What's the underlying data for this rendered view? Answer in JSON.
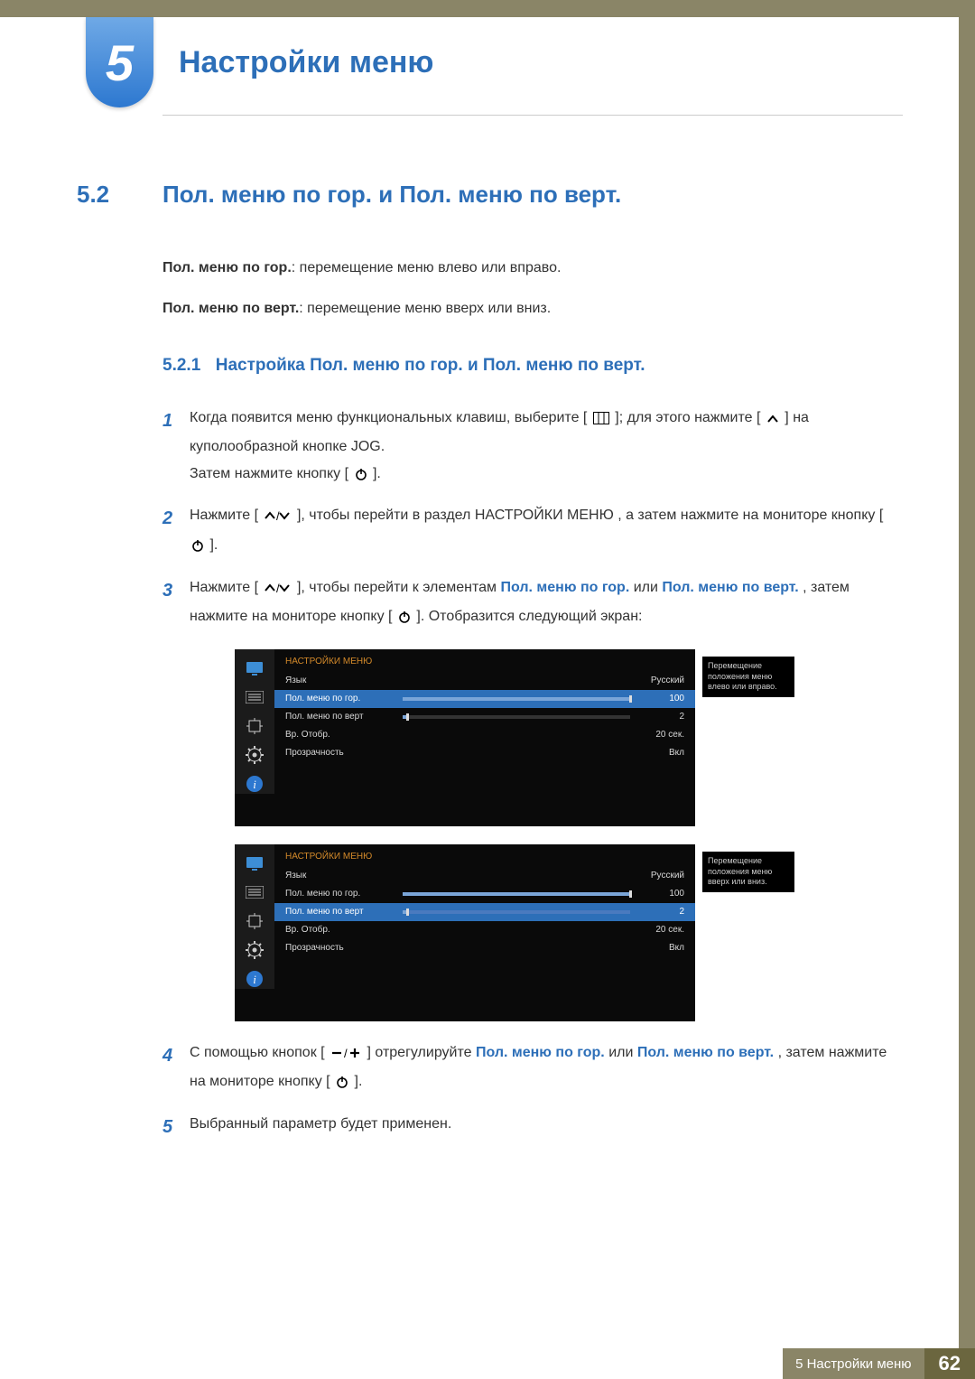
{
  "chapter": {
    "number": "5",
    "title": "Настройки меню"
  },
  "section": {
    "number": "5.2",
    "title": "Пол. меню по гор. и Пол. меню по верт."
  },
  "desc": {
    "h_label": "Пол. меню по гор.",
    "h_text": ": перемещение меню влево или вправо.",
    "v_label": "Пол. меню по верт.",
    "v_text": ": перемещение меню вверх или вниз."
  },
  "subsection": {
    "number": "5.2.1",
    "title": "Настройка Пол. меню по гор. и Пол. меню по верт."
  },
  "steps": {
    "s1a": "Когда появится меню функциональных клавиш, выберите [",
    "s1b": "]; для этого нажмите [",
    "s1c": "] на куполообразной кнопке JOG.",
    "s1d": "Затем нажмите кнопку [",
    "s1e": "].",
    "s2a": "Нажмите [",
    "s2b": "], чтобы перейти в раздел ",
    "s2c": "НАСТРОЙКИ МЕНЮ",
    "s2d": ", а затем нажмите на мониторе кнопку [",
    "s2e": "].",
    "s3a": "Нажмите [",
    "s3b": "], чтобы перейти к элементам ",
    "s3c": "Пол. меню по гор.",
    "s3d": " или ",
    "s3e": "Пол. меню по верт.",
    "s3f": ", затем нажмите на мониторе кнопку [",
    "s3g": "]. Отобразится следующий экран:",
    "s4a": "С помощью кнопок [",
    "s4b": "] отрегулируйте ",
    "s4c": "Пол. меню по гор.",
    "s4d": " или ",
    "s4e": "Пол. меню по верт.",
    "s4f": ", затем нажмите на мониторе кнопку [",
    "s4g": "].",
    "s5": "Выбранный параметр будет применен."
  },
  "osd1": {
    "title": "НАСТРОЙКИ МЕНЮ",
    "rows": [
      {
        "label": "Язык",
        "value": "Русский"
      },
      {
        "label": "Пол. меню по гор.",
        "value": "100",
        "slider": 100,
        "selected": true
      },
      {
        "label": "Пол. меню по верт",
        "value": "2",
        "slider": 2
      },
      {
        "label": "Вр. Отобр.",
        "value": "20 сек."
      },
      {
        "label": "Прозрачность",
        "value": "Вкл"
      }
    ],
    "tooltip": "Перемещение положения меню влево или вправо."
  },
  "osd2": {
    "title": "НАСТРОЙКИ МЕНЮ",
    "rows": [
      {
        "label": "Язык",
        "value": "Русский"
      },
      {
        "label": "Пол. меню по гор.",
        "value": "100",
        "slider": 100
      },
      {
        "label": "Пол. меню по верт",
        "value": "2",
        "slider": 2,
        "selected": true
      },
      {
        "label": "Вр. Отобр.",
        "value": "20 сек."
      },
      {
        "label": "Прозрачность",
        "value": "Вкл"
      }
    ],
    "tooltip": "Перемещение положения меню вверх или вниз."
  },
  "footer": {
    "label": "5 Настройки меню",
    "page": "62"
  }
}
